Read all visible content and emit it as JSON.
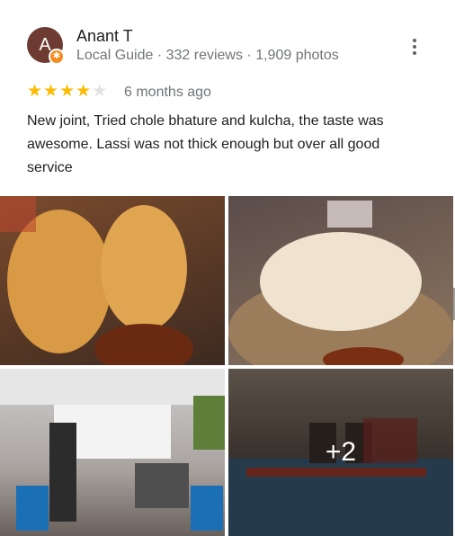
{
  "reviewer": {
    "initial": "A",
    "name": "Anant T",
    "meta": "Local Guide · 332 reviews · 1,909 photos",
    "avatar_color": "#6d3b32",
    "badge_color": "#f58b1f"
  },
  "rating": {
    "value": 4,
    "max": 5,
    "star_color": "#fbbc04"
  },
  "time_ago": "6 months ago",
  "review_text": "New joint, Tried chole bhature and kulcha, the taste was awesome. Lassi was not thick enough but over all good service",
  "photos": {
    "more_label": "+2"
  },
  "icons": {
    "menu": "more-vert-icon",
    "badge": "local-guide-badge-icon",
    "star": "star-icon"
  }
}
